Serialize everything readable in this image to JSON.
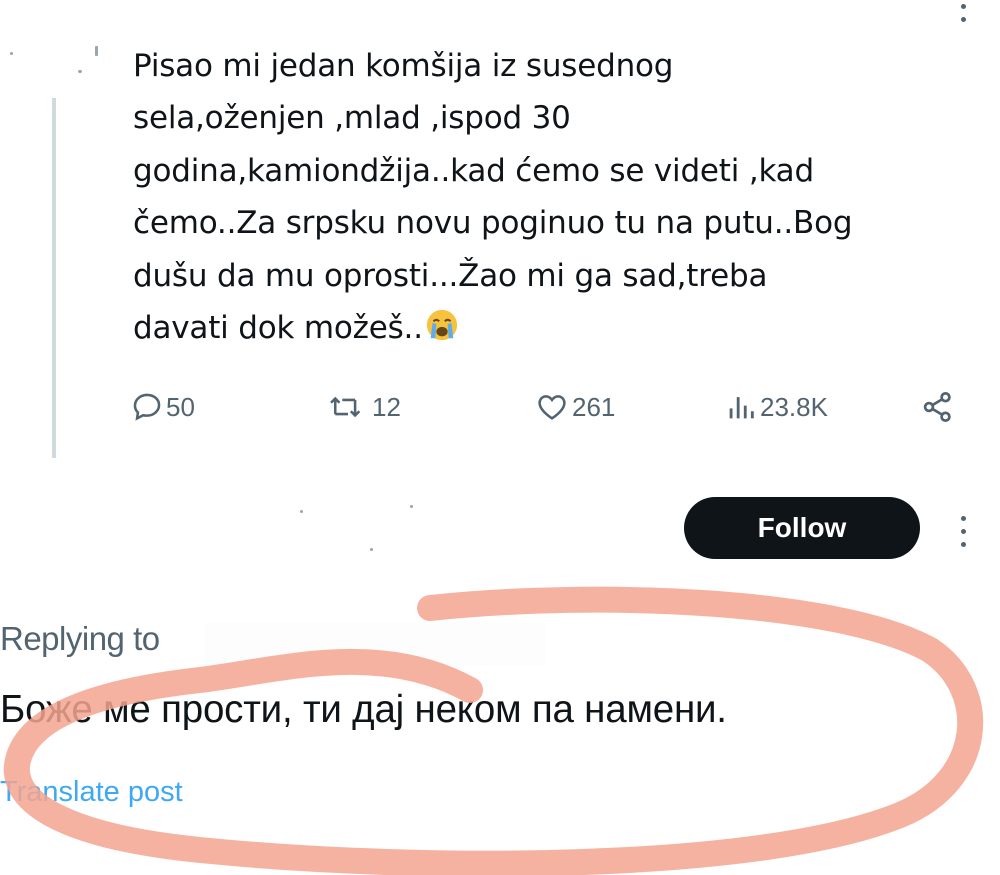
{
  "tweet": {
    "text_lines": [
      "Pisao mi jedan komšija iz susednog",
      "sela,oženjen ,mlad ,ispod 30",
      "godina,kamiondžija..kad ćemo se videti ,kad",
      "čemo..Za srpsku novu poginuo tu na putu..Bog",
      "dušu da mu oprosti...Žao mi ga sad,treba",
      "davati dok možeš.."
    ],
    "emoji": "loudly-crying-face",
    "actions": {
      "replies": "50",
      "reposts": "12",
      "likes": "261",
      "views": "23.8K"
    }
  },
  "follow_button": {
    "label": "Follow"
  },
  "reply": {
    "replying_to_label": "Replying to",
    "text": "Боже ме прости, ти дај неком па намени.",
    "translate_label": "Translate post"
  },
  "colors": {
    "text": "#0f1419",
    "muted": "#536471",
    "link": "#1d9bf0",
    "button_bg": "#0f1419",
    "annotation": "#f4a48f"
  },
  "icons": [
    "reply-icon",
    "repost-icon",
    "like-icon",
    "views-icon",
    "share-icon",
    "more-icon",
    "annotation-circle"
  ]
}
